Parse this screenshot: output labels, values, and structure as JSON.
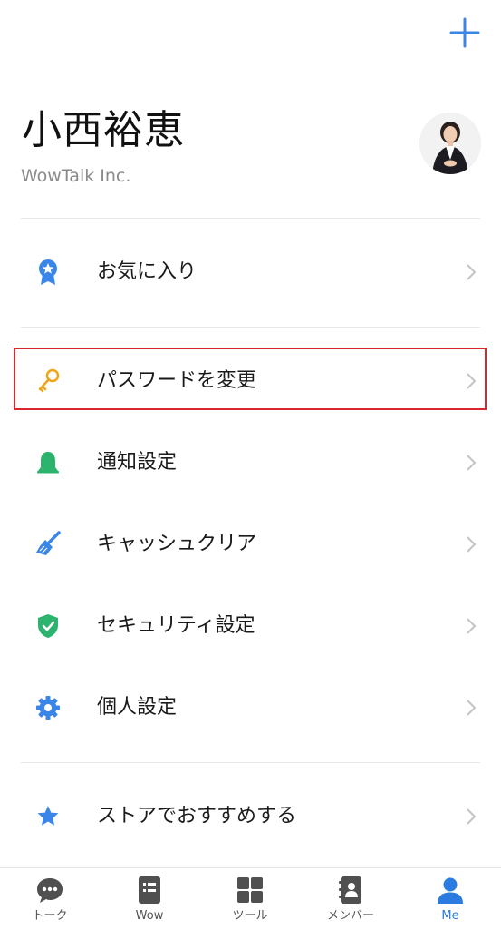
{
  "header": {
    "add_icon": "plus-icon"
  },
  "profile": {
    "name": "小西裕恵",
    "company": "WowTalk Inc.",
    "avatar": "avatar-photo"
  },
  "menu": {
    "items": [
      {
        "label": "お気に入り",
        "icon": "ribbon-star-icon",
        "color": "#3a86e8"
      },
      {
        "label": "パスワードを変更",
        "icon": "key-icon",
        "color": "#f0a418"
      },
      {
        "label": "通知設定",
        "icon": "bell-icon",
        "color": "#2cb36e"
      },
      {
        "label": "キャッシュクリア",
        "icon": "broom-icon",
        "color": "#3a86e8"
      },
      {
        "label": "セキュリティ設定",
        "icon": "shield-check-icon",
        "color": "#2cb36e"
      },
      {
        "label": "個人設定",
        "icon": "gear-icon",
        "color": "#3a86e8"
      },
      {
        "label": "ストアでおすすめする",
        "icon": "star-icon",
        "color": "#3a86e8"
      }
    ],
    "highlight_color": "#d9262e"
  },
  "tabbar": {
    "tabs": [
      {
        "label": "トーク",
        "icon": "chat-bubble-icon",
        "active": false
      },
      {
        "label": "Wow",
        "icon": "document-list-icon",
        "active": false
      },
      {
        "label": "ツール",
        "icon": "grid-icon",
        "active": false
      },
      {
        "label": "メンバー",
        "icon": "contacts-book-icon",
        "active": false
      },
      {
        "label": "Me",
        "icon": "person-icon",
        "active": true
      }
    ],
    "active_color": "#2b7be0",
    "inactive_color": "#555555"
  },
  "colors": {
    "accent": "#2b7be0",
    "divider": "#e8e8e8"
  }
}
